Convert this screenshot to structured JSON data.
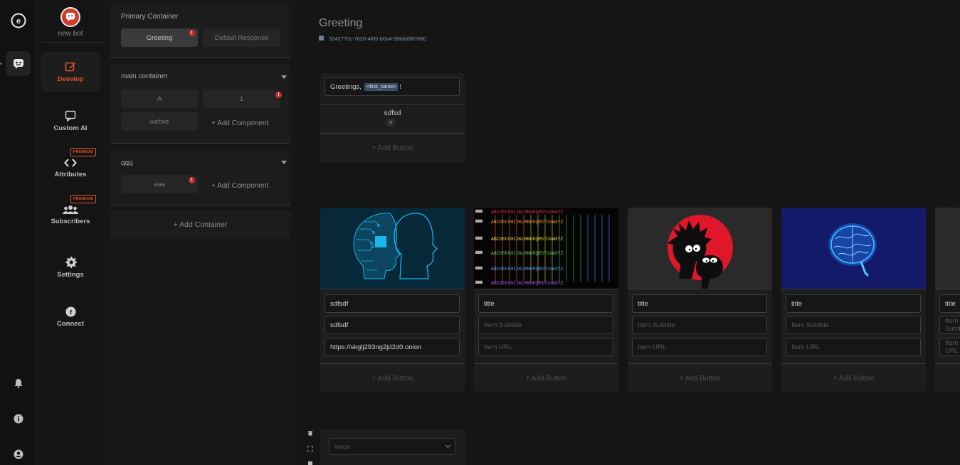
{
  "rail": {
    "logo_icon": "circle-letter-e-logo",
    "bot_icon": "chat-bot-icon",
    "bottom_icons": [
      "bell-icon",
      "info-icon",
      "user-icon"
    ]
  },
  "sidebar": {
    "bot_name": "new bot",
    "items": [
      {
        "label": "Develop",
        "icon": "edit-icon",
        "active": true
      },
      {
        "label": "Custom AI",
        "icon": "chat-bubble-icon"
      },
      {
        "label": "Attributes",
        "icon": "code-brackets-icon",
        "badge": "PREMIUM"
      },
      {
        "label": "Subscribers",
        "icon": "users-icon",
        "badge": "PREMIUM"
      },
      {
        "label": "Settings",
        "icon": "gear-icon"
      },
      {
        "label": "Connect",
        "icon": "facebook-icon"
      }
    ]
  },
  "containers": {
    "primary": {
      "title": "Primary Container",
      "blocks": [
        "Greeting",
        "Default Response"
      ]
    },
    "main": {
      "title": "main container",
      "blocks": [
        "A",
        "1",
        "wefwe"
      ],
      "add_label": "+ Add Component"
    },
    "qqq": {
      "title": "qqq",
      "blocks": [
        "aaa"
      ],
      "add_label": "+ Add Component"
    },
    "add_container_label": "+ Add Container"
  },
  "main": {
    "title": "Greeting",
    "id": "3242770c-7626-4f85-b0a4-98bfdd8f7080",
    "text_card": {
      "text_prefix": "Greetings, ",
      "tag": "<first_name>",
      "text_suffix": "!",
      "quick_reply_title": "sdfsd",
      "quick_reply_badge": "A",
      "add_button": "+ Add Button"
    },
    "gallery": [
      {
        "image": "ai-head-circuit-image",
        "title": "sdfsdf",
        "subtitle": "sdfsdf",
        "url": "https://skglj293ng2jd2d0.onion",
        "add_button": "+ Add Button"
      },
      {
        "image": "colorful-cipher-chart-image",
        "title_placeholder": "title",
        "subtitle_placeholder": "Item Subtitle",
        "url_placeholder": "Item URL",
        "add_button": "+ Add Button"
      },
      {
        "image": "rick-morty-silhouette-image",
        "title_placeholder": "title",
        "subtitle_placeholder": "Item Subtitle",
        "url_placeholder": "Item URL",
        "add_button": "+ Add Button"
      },
      {
        "image": "glowing-brain-image",
        "title_placeholder": "title",
        "subtitle_placeholder": "Item Subtitle",
        "url_placeholder": "Item URL",
        "add_button": "+ Add Button"
      },
      {
        "title_placeholder": "title",
        "subtitle_placeholder": "Item Subtitle",
        "url_placeholder": "Item URL"
      }
    ],
    "image_card": {
      "select_placeholder": "Image"
    }
  },
  "colors": {
    "accent": "#e0562e",
    "error": "#c83030"
  }
}
